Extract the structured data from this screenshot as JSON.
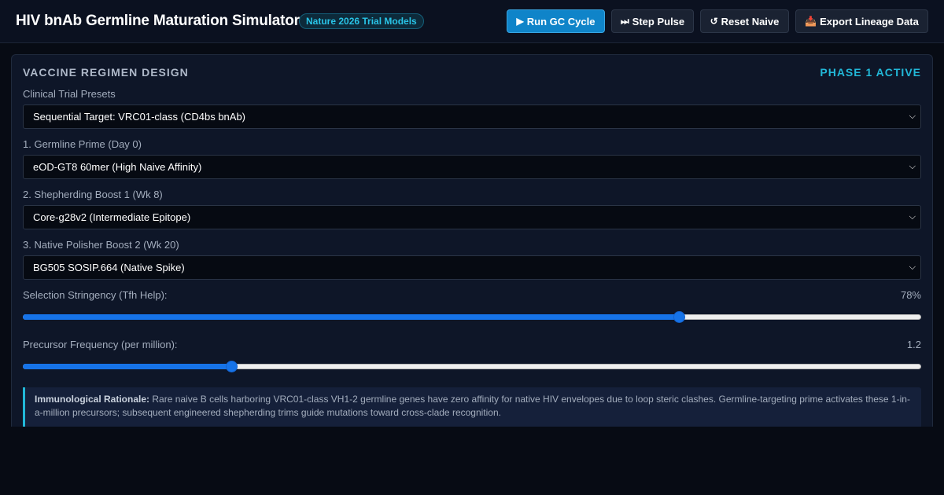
{
  "header": {
    "title": "HIV bnAb Germline Maturation Simulator",
    "badge": "Nature 2026 Trial Models",
    "buttons": {
      "run": {
        "icon": "▶",
        "label": "Run GC Cycle"
      },
      "step": {
        "icon": "⏭",
        "label": "Step Pulse"
      },
      "reset": {
        "icon": "↺",
        "label": "Reset Naive"
      },
      "export": {
        "icon": "📥",
        "label": "Export Lineage Data"
      }
    }
  },
  "panel": {
    "title": "VACCINE REGIMEN DESIGN",
    "phase": "PHASE 1 ACTIVE",
    "preset": {
      "label": "Clinical Trial Presets",
      "value": "Sequential Target: VRC01-class (CD4bs bnAb)"
    },
    "prime": {
      "label": "1. Germline Prime (Day 0)",
      "value": "eOD-GT8 60mer (High Naive Affinity)"
    },
    "boost1": {
      "label": "2. Shepherding Boost 1 (Wk 8)",
      "value": "Core-g28v2 (Intermediate Epitope)"
    },
    "boost2": {
      "label": "3. Native Polisher Boost 2 (Wk 20)",
      "value": "BG505 SOSIP.664 (Native Spike)"
    },
    "stringency": {
      "label": "Selection Stringency (Tfh Help):",
      "display": "78%",
      "level": 0.73
    },
    "precursor": {
      "label": "Precursor Frequency (per million):",
      "display": "1.2",
      "level": 0.232
    },
    "rationale": {
      "heading": "Immunological Rationale:",
      "text": "Rare naive B cells harboring VRC01-class VH1-2 germline genes have zero affinity for native HIV envelopes due to loop steric clashes. Germline-targeting prime activates these 1-in-a-million precursors; subsequent engineered shepherding trims guide mutations toward cross-clade recognition."
    }
  },
  "colors": {
    "accent": "#22b8d8",
    "primary_button": "#0f84c9",
    "slider_fill": "#1673e8"
  }
}
